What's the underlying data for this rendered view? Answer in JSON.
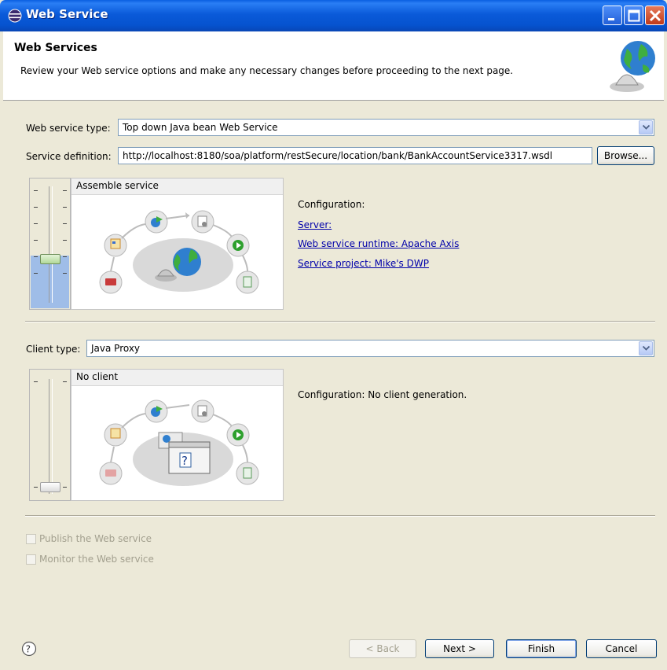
{
  "window": {
    "title": "Web Service",
    "colors": {
      "titlebar": "#0a5ad9",
      "link": "#0000aa",
      "slider_fill": "#9fbde8"
    }
  },
  "header": {
    "title": "Web Services",
    "description": "Review your Web service options and make any necessary changes before proceeding to the next page.",
    "icon": "web-service-globe-icon"
  },
  "service": {
    "type_label": "Web service type:",
    "type_value": "Top down Java bean Web Service",
    "definition_label": "Service definition:",
    "definition_value": "http://localhost:8180/soa/platform/restSecure/location/bank/BankAccountService3317.wsdl",
    "browse_label": "Browse...",
    "slider_level": "Assemble service",
    "panel_title": "Assemble service",
    "config_label": "Configuration:",
    "server_link": "Server: ",
    "runtime_link": "Web service runtime: Apache Axis",
    "project_link": "Service project: Mike's DWP"
  },
  "client": {
    "type_label": "Client type:",
    "type_value": "Java Proxy",
    "slider_level": "No client",
    "panel_title": "No client",
    "config_text": "Configuration: No client generation."
  },
  "options": {
    "publish_label": "Publish the Web service",
    "publish_checked": false,
    "monitor_label": "Monitor the Web service",
    "monitor_checked": false
  },
  "footer": {
    "help_icon": "help-icon",
    "back_label": "< Back",
    "next_label": "Next >",
    "finish_label": "Finish",
    "cancel_label": "Cancel"
  }
}
